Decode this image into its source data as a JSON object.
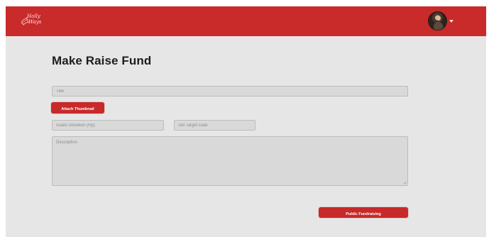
{
  "header": {
    "logo": {
      "line1": "Holly",
      "line2": "Ways",
      "icon": "holly-leaf-icon"
    },
    "avatar": {
      "icon": "user-avatar"
    },
    "dropdown_icon": "chevron-down-icon"
  },
  "main": {
    "title": "Make Raise Fund",
    "fields": {
      "title_placeholder": "Title",
      "goal_placeholder": "Goals Donation (Rp)",
      "date_placeholder": "Set Target Date",
      "description_placeholder": "Description"
    },
    "buttons": {
      "attach_thumbnail": "Attach Thumbnail",
      "publish": "Public Fundraising"
    }
  },
  "colors": {
    "brand_red": "#c92a2a",
    "page_background": "#e6e6e6",
    "input_background": "#d9d9d9"
  }
}
